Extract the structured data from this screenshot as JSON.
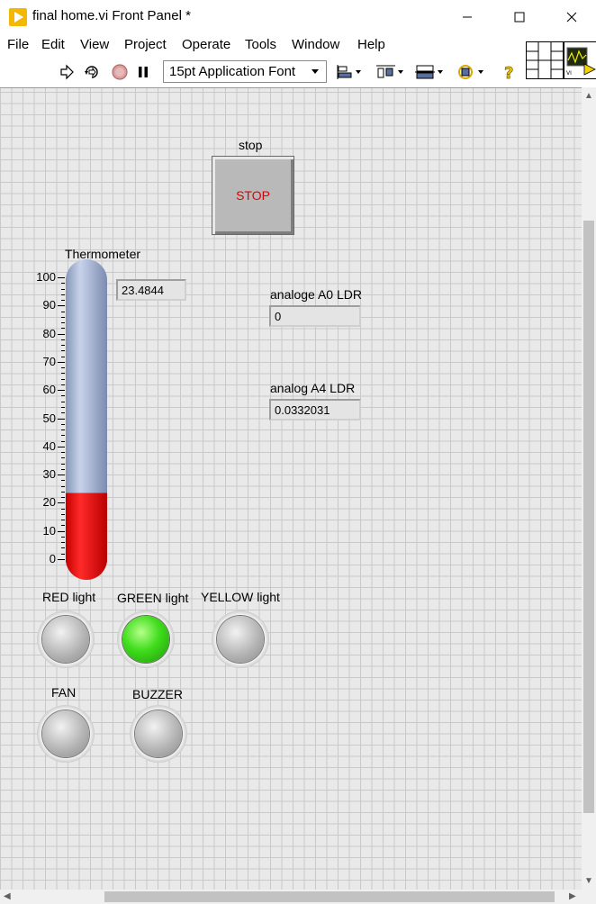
{
  "window": {
    "title": "final home.vi Front Panel *"
  },
  "menu": {
    "items": [
      "File",
      "Edit",
      "View",
      "Project",
      "Operate",
      "Tools",
      "Window",
      "Help"
    ]
  },
  "toolbar": {
    "icons": [
      "run-arrow",
      "run-continuously",
      "abort-execution",
      "pause",
      "align-objects",
      "distribute-objects",
      "resize-objects",
      "reorder",
      "context-help"
    ],
    "font_select": "15pt Application Font"
  },
  "panel": {
    "stop": {
      "label": "stop",
      "button_text": "STOP"
    },
    "thermometer": {
      "label": "Thermometer",
      "value": "23.4844",
      "level": 23.4844,
      "scale": [
        100,
        90,
        80,
        70,
        60,
        50,
        40,
        30,
        20,
        10,
        0
      ],
      "fill_color": "#ff0000",
      "tube_color": "#a8b6d6"
    },
    "analog_a0": {
      "label": "analoge A0 LDR",
      "value": "0"
    },
    "analog_a4": {
      "label": "analog A4 LDR",
      "value": "0.0332031"
    },
    "leds": [
      {
        "label": "RED light",
        "on": false
      },
      {
        "label": "GREEN light",
        "on": true,
        "color": "#3fdc1c"
      },
      {
        "label": "YELLOW light",
        "on": false
      },
      {
        "label": "FAN",
        "on": false
      },
      {
        "label": "BUZZER",
        "on": false
      }
    ]
  }
}
